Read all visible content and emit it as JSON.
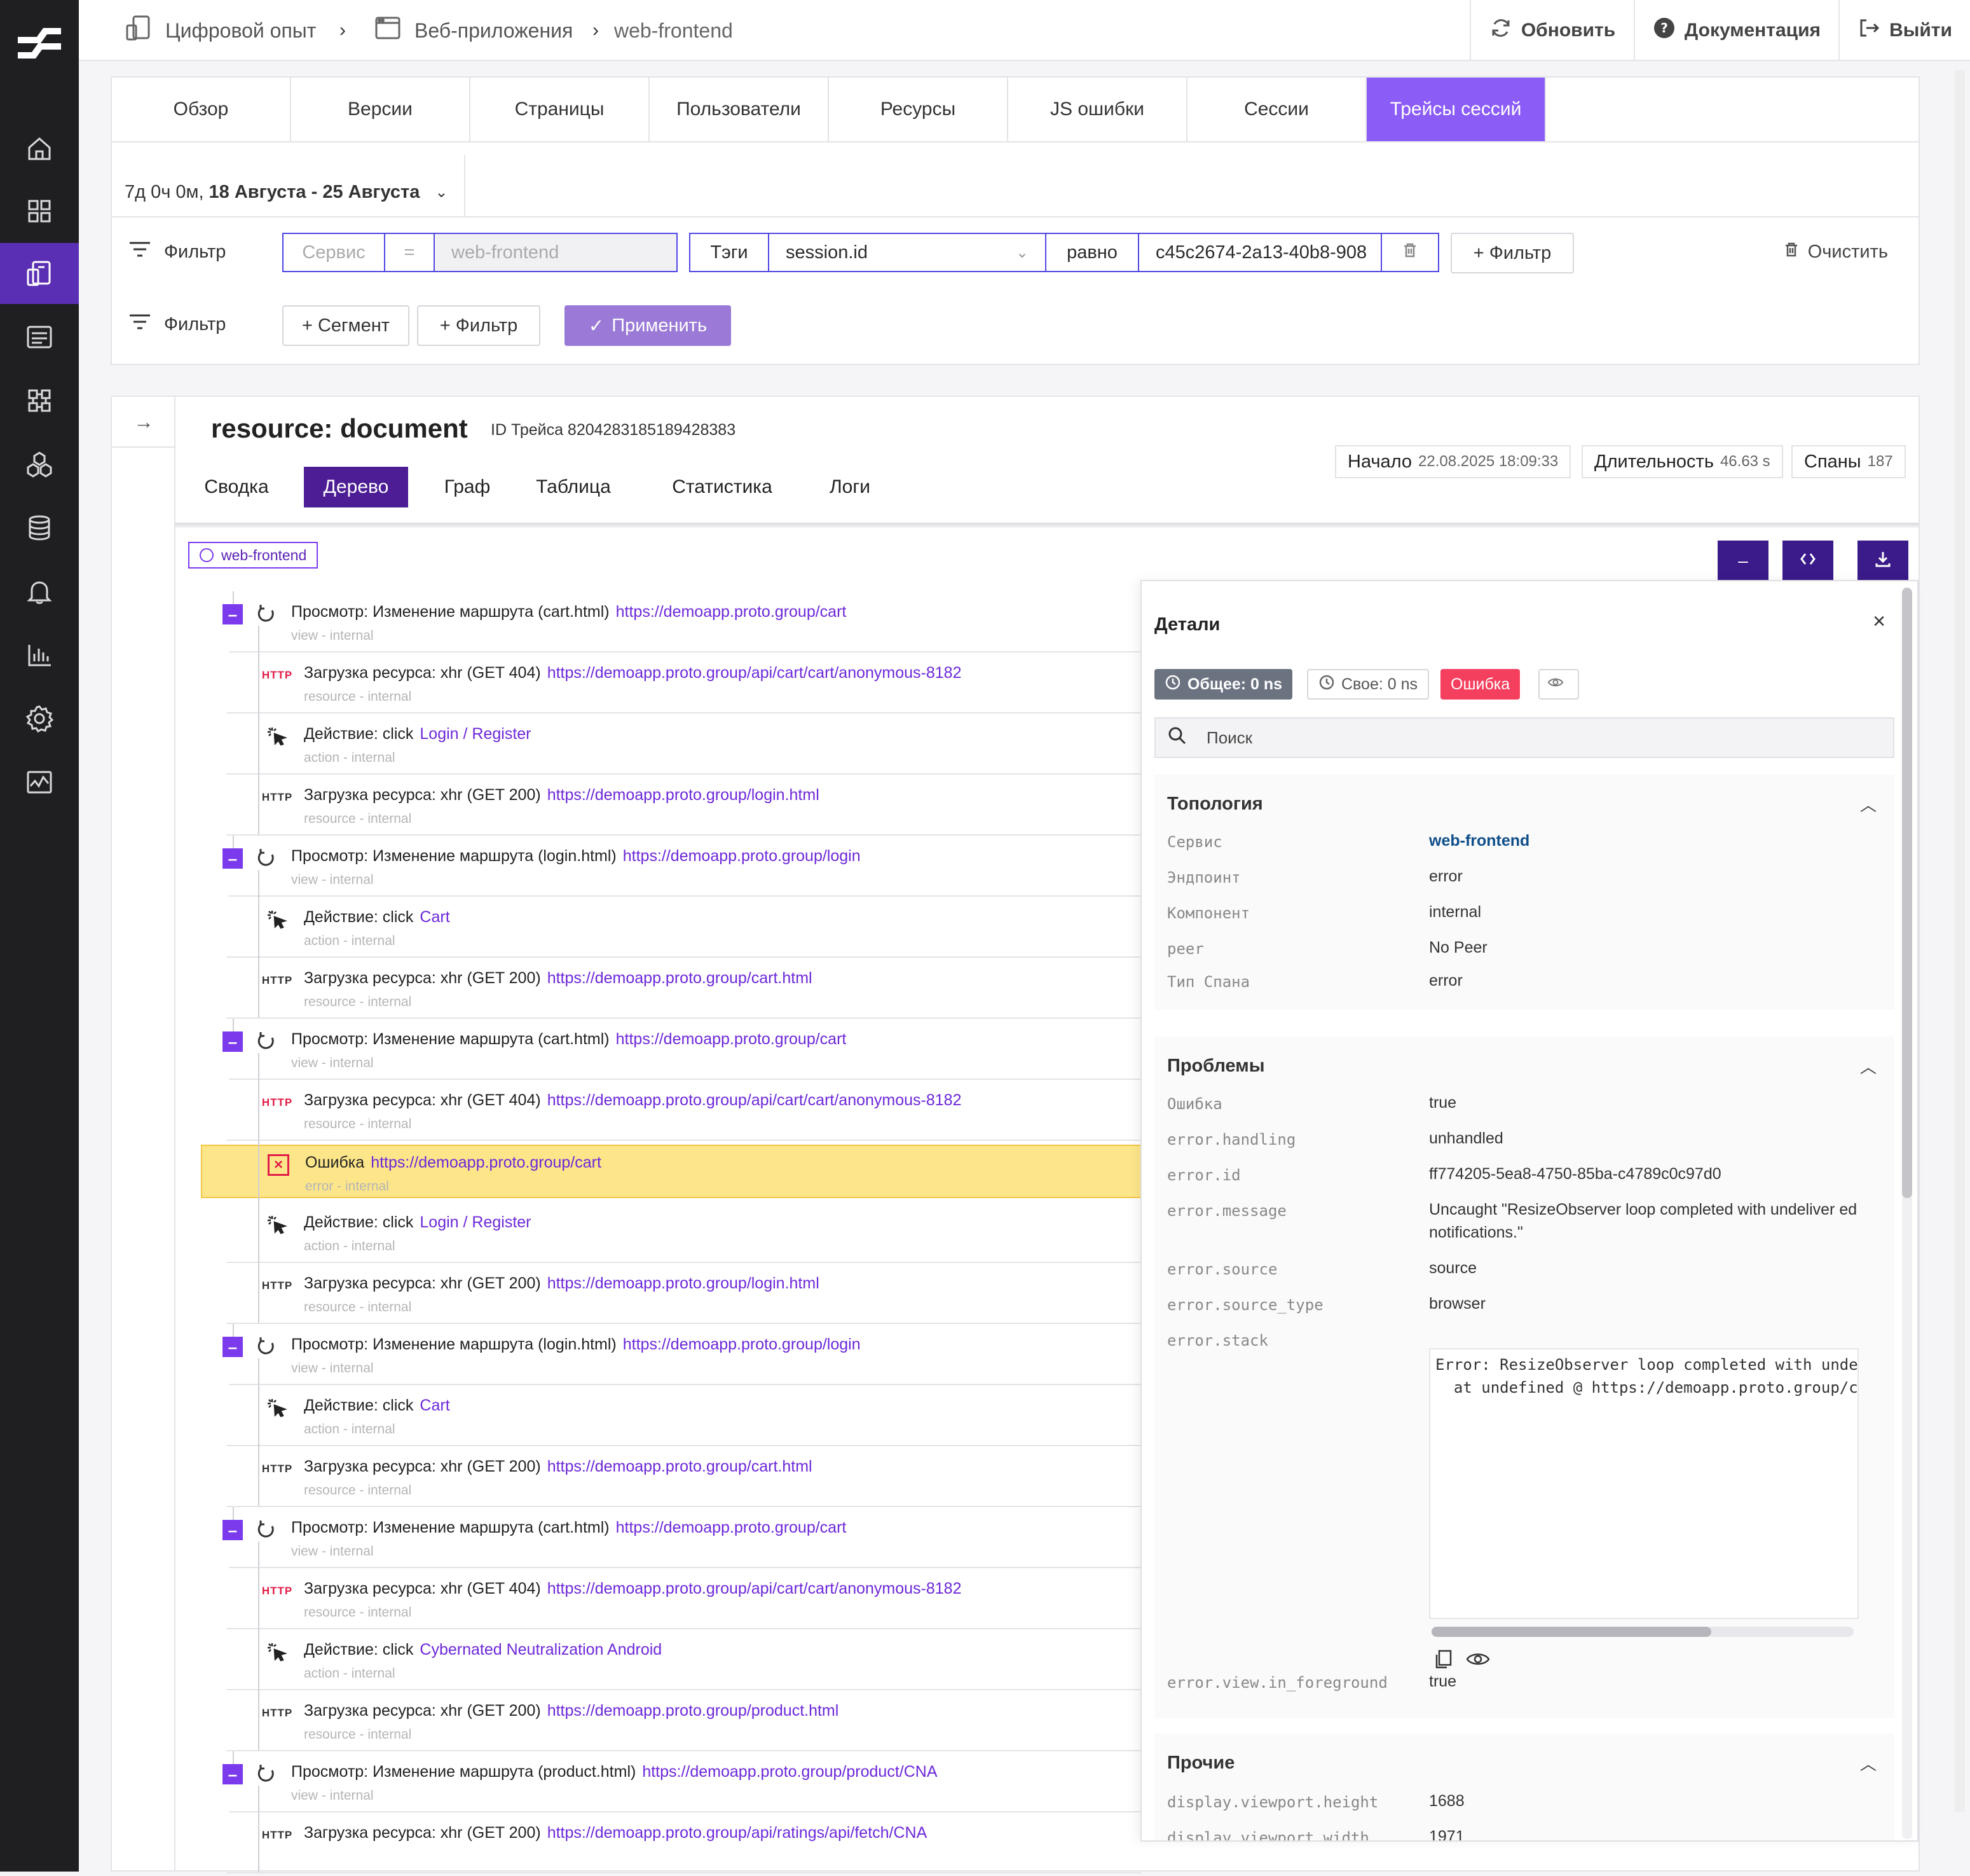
{
  "breadcrumbs": [
    {
      "label": "Цифровой опыт",
      "icon": "devices-icon"
    },
    {
      "label": "Веб-приложения",
      "icon": "browser-window-icon"
    },
    {
      "label": "web-frontend"
    }
  ],
  "topbar": {
    "refresh": "Обновить",
    "docs": "Документация",
    "logout": "Выйти"
  },
  "tabs": [
    "Обзор",
    "Версии",
    "Страницы",
    "Пользователи",
    "Ресурсы",
    "JS ошибки",
    "Сессии",
    "Трейсы сессий"
  ],
  "active_tab": "Трейсы сессий",
  "date_range": {
    "prefix": "7д 0ч 0м,",
    "value": "18 Августа - 25 Августа"
  },
  "filter1": {
    "label": "Фильтр",
    "service_key": "Сервис",
    "op": "=",
    "service_value": "web-frontend",
    "tags": "Тэги",
    "tag_key": "session.id",
    "equals": "равно",
    "tag_value": "c45c2674-2a13-40b8-908",
    "add_filter": "+ Фильтр",
    "clear": "Очистить"
  },
  "filter2": {
    "label": "Фильтр",
    "add_segment": "+ Сегмент",
    "add_filter": "+ Фильтр",
    "apply": "Применить"
  },
  "trace": {
    "title": "resource: document",
    "id_label": "ID Трейса 8204283185189428383",
    "start_label": "Начало",
    "start_value": "22.08.2025 18:09:33",
    "duration_label": "Длительность",
    "duration_value": "46.63 s",
    "spans_label": "Спаны",
    "spans_value": "187",
    "views": [
      "Сводка",
      "Дерево",
      "Граф",
      "Таблица",
      "Статистика",
      "Логи"
    ],
    "active_view": "Дерево",
    "service_tag": "web-frontend",
    "tools": {
      "minus": "–"
    }
  },
  "spans": [
    {
      "kind": "view",
      "text": "Просмотр: Изменение маршрута (cart.html)",
      "link": "https://demoapp.proto.group/cart",
      "sub": "view - internal"
    },
    {
      "kind": "http-err",
      "text": "Загрузка ресурса: xhr (GET 404)",
      "link": "https://demoapp.proto.group/api/cart/cart/anonymous-8182",
      "sub": "resource - internal"
    },
    {
      "kind": "action",
      "text": "Действие: click",
      "link": "Login / Register",
      "sub": "action - internal"
    },
    {
      "kind": "http",
      "text": "Загрузка ресурса: xhr (GET 200)",
      "link": "https://demoapp.proto.group/login.html",
      "sub": "resource - internal"
    },
    {
      "kind": "view",
      "text": "Просмотр: Изменение маршрута (login.html)",
      "link": "https://demoapp.proto.group/login",
      "sub": "view - internal"
    },
    {
      "kind": "action",
      "text": "Действие: click",
      "link": "Cart",
      "sub": "action - internal"
    },
    {
      "kind": "http",
      "text": "Загрузка ресурса: xhr (GET 200)",
      "link": "https://demoapp.proto.group/cart.html",
      "sub": "resource - internal"
    },
    {
      "kind": "view",
      "text": "Просмотр: Изменение маршрута (cart.html)",
      "link": "https://demoapp.proto.group/cart",
      "sub": "view - internal"
    },
    {
      "kind": "http-err",
      "text": "Загрузка ресурса: xhr (GET 404)",
      "link": "https://demoapp.proto.group/api/cart/cart/anonymous-8182",
      "sub": "resource - internal"
    },
    {
      "kind": "error",
      "text": "Ошибка",
      "link": "https://demoapp.proto.group/cart",
      "sub": "error - internal"
    },
    {
      "kind": "action",
      "text": "Действие: click",
      "link": "Login / Register",
      "sub": "action - internal"
    },
    {
      "kind": "http",
      "text": "Загрузка ресурса: xhr (GET 200)",
      "link": "https://demoapp.proto.group/login.html",
      "sub": "resource - internal"
    },
    {
      "kind": "view",
      "text": "Просмотр: Изменение маршрута (login.html)",
      "link": "https://demoapp.proto.group/login",
      "sub": "view - internal"
    },
    {
      "kind": "action",
      "text": "Действие: click",
      "link": "Cart",
      "sub": "action - internal"
    },
    {
      "kind": "http",
      "text": "Загрузка ресурса: xhr (GET 200)",
      "link": "https://demoapp.proto.group/cart.html",
      "sub": "resource - internal"
    },
    {
      "kind": "view",
      "text": "Просмотр: Изменение маршрута (cart.html)",
      "link": "https://demoapp.proto.group/cart",
      "sub": "view - internal"
    },
    {
      "kind": "http-err",
      "text": "Загрузка ресурса: xhr (GET 404)",
      "link": "https://demoapp.proto.group/api/cart/cart/anonymous-8182",
      "sub": "resource - internal"
    },
    {
      "kind": "action",
      "text": "Действие: click",
      "link": "Cybernated Neutralization Android",
      "sub": "action - internal"
    },
    {
      "kind": "http",
      "text": "Загрузка ресурса: xhr (GET 200)",
      "link": "https://demoapp.proto.group/product.html",
      "sub": "resource - internal"
    },
    {
      "kind": "view",
      "text": "Просмотр: Изменение маршрута (product.html)",
      "link": "https://demoapp.proto.group/product/CNA",
      "sub": "view - internal"
    },
    {
      "kind": "http",
      "text": "Загрузка ресурса: xhr (GET 200)",
      "link": "https://demoapp.proto.group/api/ratings/api/fetch/CNA",
      "sub": ""
    }
  ],
  "http_badge": "HTTP",
  "details": {
    "title": "Детали",
    "total": "Общее: 0 ns",
    "self": "Свое: 0 ns",
    "error_badge": "Ошибка",
    "search_placeholder": "Поиск",
    "topology": {
      "title": "Топология",
      "rows": [
        {
          "k": "Сервис",
          "v": "web-frontend"
        },
        {
          "k": "Эндпоинт",
          "v": "error"
        },
        {
          "k": "Компонент",
          "v": "internal"
        },
        {
          "k": "peer",
          "v": "No Peer"
        },
        {
          "k": "Тип Спана",
          "v": "error"
        }
      ]
    },
    "problems": {
      "title": "Проблемы",
      "rows": [
        {
          "k": "Ошибка",
          "v": "true"
        },
        {
          "k": "error.handling",
          "v": "unhandled"
        },
        {
          "k": "error.id",
          "v": "ff774205-5ea8-4750-85ba-c4789c0c97d0"
        },
        {
          "k": "error.message",
          "v": "Uncaught \"ResizeObserver loop completed with undeliver ed notifications.\""
        },
        {
          "k": "error.source",
          "v": "source"
        },
        {
          "k": "error.source_type",
          "v": "browser"
        },
        {
          "k": "error.stack",
          "v": ""
        }
      ],
      "stack_code": "Error: ResizeObserver loop completed with unde\n  at undefined @ https://demoapp.proto.group/c",
      "foreground_key": "error.view.in_foreground",
      "foreground_value": "true"
    },
    "other": {
      "title": "Прочие",
      "rows": [
        {
          "k": "display.viewport.height",
          "v": "1688"
        },
        {
          "k": "display.viewport.width",
          "v": "1971"
        }
      ]
    }
  },
  "colors": {
    "accent": "#8b5cf6",
    "dark_accent": "#4c1d95",
    "error": "#e11d48",
    "highlight": "#fde68a",
    "rail": "#1f1f22"
  }
}
